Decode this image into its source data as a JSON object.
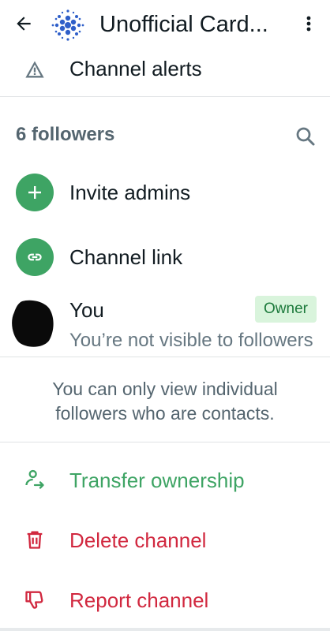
{
  "header": {
    "back_icon": "arrow-left-icon",
    "title": "Unofficial Card...",
    "overflow_icon": "more-vertical-icon",
    "logo_color": "#2f5fc9"
  },
  "alerts": {
    "label": "Channel alerts",
    "icon": "warning-triangle-icon"
  },
  "followers": {
    "count_label": "6 followers",
    "search_icon": "search-icon"
  },
  "rows": {
    "invite_admins": "Invite admins",
    "channel_link": "Channel link"
  },
  "you": {
    "name": "You",
    "badge": "Owner",
    "subtitle": "You’re not visible to followers"
  },
  "note": "You can only view individual followers who are contacts.",
  "actions": {
    "transfer": "Transfer ownership",
    "delete": "Delete channel",
    "report": "Report channel"
  },
  "colors": {
    "accent_green": "#3ea464",
    "danger_red": "#d1283f",
    "badge_bg": "#d9f4dc",
    "muted_text": "#54656f"
  }
}
